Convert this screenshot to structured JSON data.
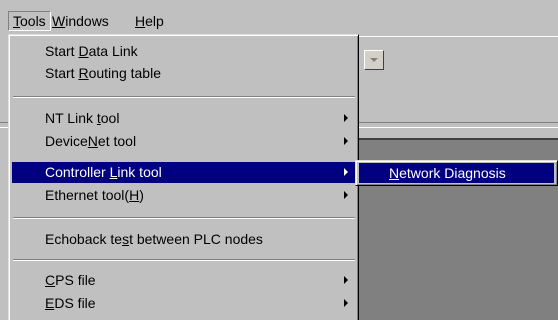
{
  "menubar": {
    "items": [
      {
        "pre": "",
        "accel": "T",
        "post": "ools"
      },
      {
        "pre": "",
        "accel": "W",
        "post": "indows"
      },
      {
        "pre": "",
        "accel": "H",
        "post": "elp"
      }
    ]
  },
  "tools_menu": {
    "items": [
      {
        "pre": "Start ",
        "accel": "D",
        "post": "ata Link"
      },
      {
        "pre": "Start ",
        "accel": "R",
        "post": "outing table"
      },
      {
        "pre": "NT Link ",
        "accel": "t",
        "post": "ool"
      },
      {
        "pre": "Device",
        "accel": "N",
        "post": "et tool"
      },
      {
        "pre": "Controller ",
        "accel": "L",
        "post": "ink tool"
      },
      {
        "pre": "Ethernet tool(",
        "accel": "H",
        "post": ")"
      },
      {
        "pre": "Echoback te",
        "accel": "s",
        "post": "t between PLC nodes"
      },
      {
        "pre": "",
        "accel": "C",
        "post": "PS file"
      },
      {
        "pre": "",
        "accel": "E",
        "post": "DS file"
      }
    ]
  },
  "submenu": {
    "item": {
      "pre": "",
      "accel": "N",
      "post": "etwork Diagnosis"
    }
  },
  "icons": {
    "submenu_arrow": "submenu-arrow-icon",
    "combo_dropdown": "chevron-down-icon"
  },
  "colors": {
    "selection": "#000080",
    "face": "#c0c0c0"
  }
}
